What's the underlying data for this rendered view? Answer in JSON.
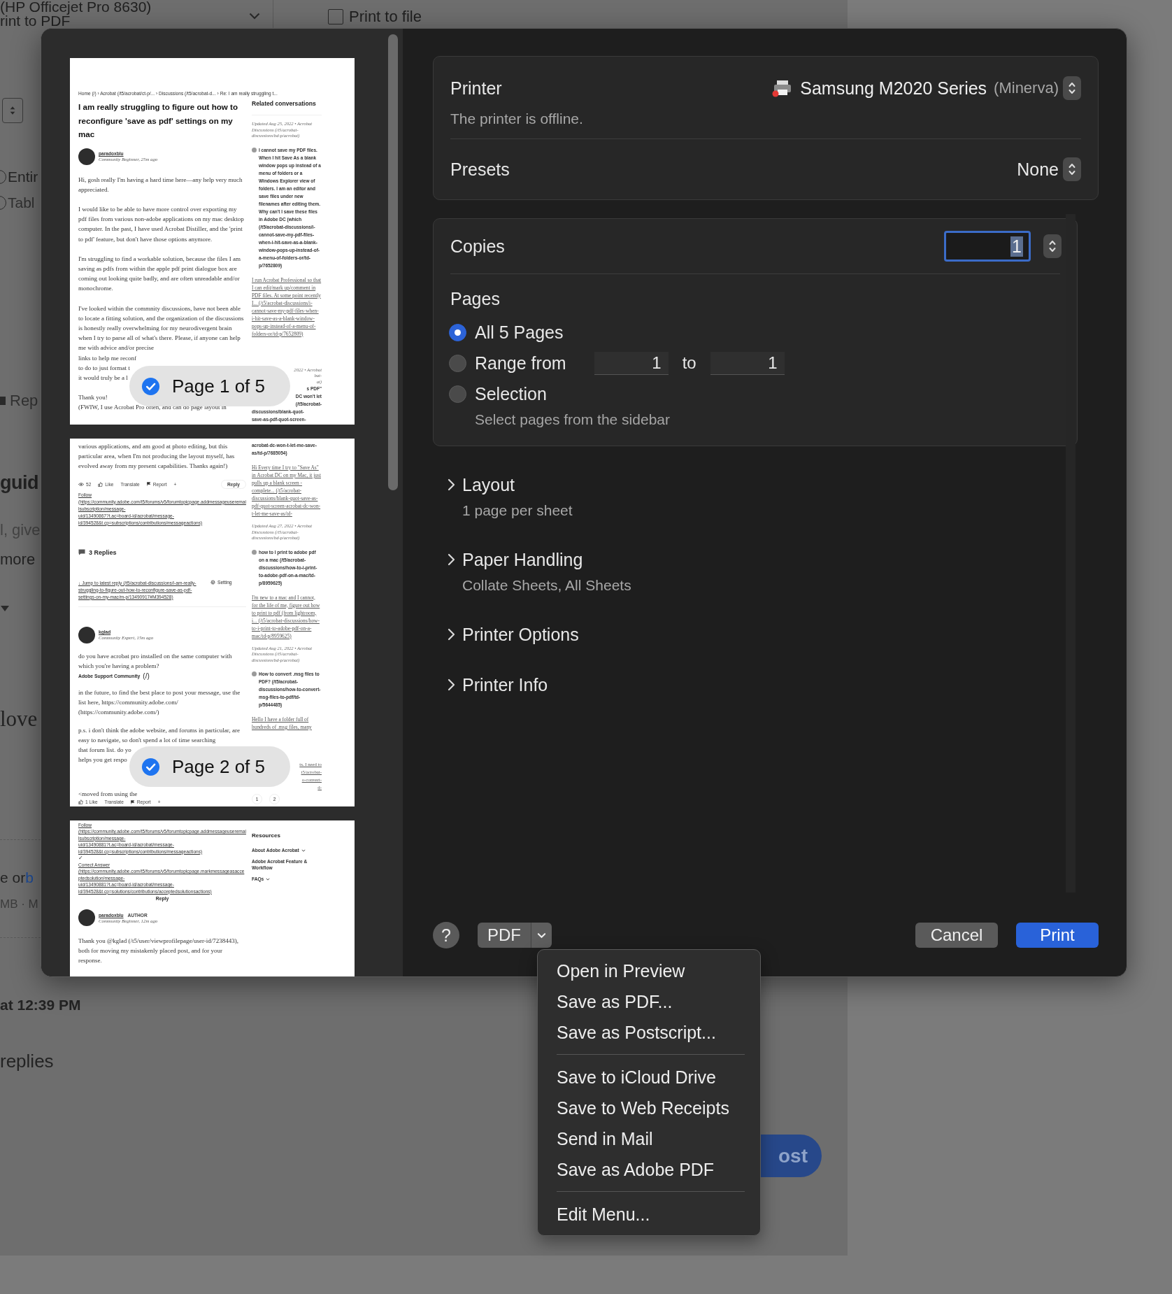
{
  "backdrop": {
    "printer_select": {
      "line_1": "(HP Officejet Pro 8630)",
      "line_2": "rint to PDF"
    },
    "print_to_file": {
      "label": "Print to file",
      "checked": false
    },
    "texts": [
      {
        "kind": "radio",
        "text": "Entir"
      },
      {
        "kind": "radio-muted",
        "text": "Tabl"
      },
      {
        "kind": "flagged",
        "text": "Rep"
      },
      {
        "kind": "heading",
        "text": "guid"
      },
      {
        "kind": "lead-muted",
        "text": "l, give"
      },
      {
        "kind": "lead",
        "text": "more"
      },
      {
        "kind": "serif",
        "text": "love"
      },
      {
        "kind": "linked",
        "text": "e or ",
        "link": "b"
      },
      {
        "kind": "meta",
        "text": "MB · M"
      },
      {
        "kind": "time",
        "text": "at 12:39 PM"
      },
      {
        "kind": "count",
        "text": "replies"
      }
    ],
    "post_button": "ost"
  },
  "preview": {
    "pages": [
      {
        "breadcrumb": "Home (/)  ›  Acrobat (/t5/acrobat/ct-p/...  ›  Discussions (/t5/acrobat-d...  ›  Re: I am really struggling t...",
        "badge": {
          "text": "Page 1 of 5",
          "checked": true
        },
        "main": [
          {
            "kind": "title",
            "text": "I am really struggling to figure out how to reconfigure 'save as pdf' settings on my mac"
          },
          {
            "kind": "author",
            "name": "paradoxblu",
            "role": "Community Beginner, 25m ago"
          },
          {
            "kind": "body",
            "text": "Hi, gosh really I'm having a hard time here—any help very much appreciated."
          },
          {
            "kind": "body",
            "text": "I would like to be able to have more control over exporting my pdf files from various non-adobe applications on my mac desktop computer. In the past, I have used Acrobat Distiller, and the 'print to pdf' feature, but don't have those options anymore."
          },
          {
            "kind": "body",
            "text": "I'm struggling to find a workable solution, because the files I am saving as pdfs from within the apple pdf print dialogue box are coming out looking quite badly, and are often unreadable and/or monochrome."
          },
          {
            "kind": "body",
            "text": "I've looked within the commnity discussions, have not been able to locate a fitting solution, and the organization of the discussions is honestly really overwhelming for my neurodivergent brain when I try to parse all of what's there. Please, if anyone can help me with advice and/or precise"
          },
          {
            "kind": "line",
            "text": "links to help me reconf"
          },
          {
            "kind": "line",
            "text": "to do to just format t"
          },
          {
            "kind": "line",
            "text": "it would truly be a l"
          },
          {
            "kind": "body",
            "text": "Thank you!"
          },
          {
            "kind": "line",
            "text": "(FWIW, I use Acrobat Pro often, and can do page layout in"
          }
        ],
        "side": [
          {
            "kind": "heading",
            "text": "Related conversations"
          },
          {
            "kind": "meta",
            "text": "Updated Aug 25, 2022 • Acrobat Discussions (/t5/acrobat-discussions/bd-p/acrobat)"
          },
          {
            "kind": "topic",
            "text": "I cannot save my PDF files. When I hit Save As a blank window pops up instead of a menu of folders or a Windows Explorer view of folders. I am an editor and save files under new filenames after editing them. Why can't I save these files in Adobe DC (which (/t5/acrobat-discussions/i-cannot-save-my-pdf-files-when-i-hit-save-as-a-blank-window-pops-up-instead-of-a-menu-of-folders-or/td-p/7652809)"
          },
          {
            "kind": "excerpt",
            "text": "I run Acrobat Professional so that I can edit/mark up/comment in PDF files. At some point recently I... (/t5/acrobat-discussions/i-cannot-save-my-pdf-files-when-i-hit-save-as-a-blank-window-pops-up-instead-of-a-menu-of-folders-or/td-p/7652809)"
          },
          {
            "kind": "meta-fragment",
            "text": "2022 • Acrobat"
          },
          {
            "kind": "meta-fragment",
            "text": "bat-"
          },
          {
            "kind": "meta-fragment",
            "text": "at)"
          },
          {
            "kind": "topic-fragment",
            "text": "s PDF\""
          },
          {
            "kind": "topic-fragment",
            "text": "DC won't let"
          },
          {
            "kind": "topic-fragment",
            "text": "(/t5/acrobat-"
          },
          {
            "kind": "topic-line",
            "text": "discussions/blank-quot-"
          },
          {
            "kind": "topic-line",
            "text": "save-as-pdf-quot-screen-"
          }
        ]
      },
      {
        "badge": {
          "text": "Page 2 of 5",
          "checked": true
        },
        "main": [
          {
            "kind": "body",
            "text": "various applications, and am good at photo editing, but this particular area, when I'm not producing the layout myself, has evolved away from my present capabilities. Thanks again!)"
          },
          {
            "kind": "actions",
            "items": [
              {
                "kind": "views",
                "text": "52"
              },
              {
                "kind": "like",
                "text": "Like"
              },
              {
                "kind": "text",
                "text": "Translate"
              },
              {
                "kind": "report",
                "text": "Report"
              },
              {
                "kind": "text",
                "text": "+"
              },
              {
                "kind": "reply",
                "text": "Reply"
              }
            ]
          },
          {
            "kind": "link-line",
            "text": "Follow"
          },
          {
            "kind": "link-line",
            "text": "(https://community.adobe.com/t5/forums/v5/forumtopicpage.addmessageuseremailsubscription/message-"
          },
          {
            "kind": "link-line",
            "text": "uid/13490867?t.ac=board-id/acrobat/message-"
          },
          {
            "kind": "link-line",
            "text": "id/394528&t.cp=subscriptions/contributions/messageactions)"
          },
          {
            "kind": "replies",
            "text": "3 Replies"
          },
          {
            "kind": "jump",
            "text": "↓ Jump to latest reply (/t5/acrobat-discussions/i-am-really-struggling-to-figure-out-how-to-reconfigure-save-as-pdf-settings-on-my-mac/m-p/13490917#M394528)",
            "setting": "Setting"
          },
          {
            "kind": "author",
            "name": "kglad",
            "role": "Community Expert, 15m ago"
          },
          {
            "kind": "body",
            "text": "do you have acrobat pro installed on the same computer with which you're having a problem?"
          },
          {
            "kind": "site-header",
            "text": "Adobe Support Community",
            "link": "(/)"
          },
          {
            "kind": "body",
            "text": "in the future, to find the best place to post your message, use the list here, https://community.adobe.com/ (https://community.adobe.com/)"
          },
          {
            "kind": "body",
            "text": "p.s. i don't think the adobe website, and forums in particular, are easy to navigate, so don't spend a lot of time searching"
          },
          {
            "kind": "line",
            "text": "that forum list. do yo"
          },
          {
            "kind": "line",
            "text": "helps you get respo"
          },
          {
            "kind": "body",
            "text": "<moved from using the"
          },
          {
            "kind": "actions",
            "items": [
              {
                "kind": "like",
                "text": "1 Like"
              },
              {
                "kind": "text",
                "text": "Translate"
              },
              {
                "kind": "report",
                "text": "Report"
              },
              {
                "kind": "text",
                "text": "+"
              }
            ]
          }
        ],
        "side": [
          {
            "kind": "topic-line",
            "text": "acrobat-dc-won-t-let-me-save-as/td-p/7685054)"
          },
          {
            "kind": "excerpt",
            "text": "Hi Every time I try to \"Save As\" in Acrobat DC on my Mac, it just pulls up a blank screen - complete... (/t5/acrobat-discussions/blank-quot-save-as-pdf-quot-screen-acrobat-dc-won-t-let-me-save-as/td-"
          },
          {
            "kind": "meta",
            "text": "Updated Aug 27, 2022 • Acrobat Discussions (/t5/acrobat-discussions/bd-p/acrobat)"
          },
          {
            "kind": "topic",
            "text": "how to I print to adobe pdf on a mac (/t5/acrobat-discussions/how-to-i-print-to-adobe-pdf-on-a-mac/td-p/8959625)"
          },
          {
            "kind": "excerpt",
            "text": "I'm new to a mac and I cannot, for the life of me, figure out how to print to pdf (from lightroom, i... (/t5/acrobat-discussions/how-to-i-print-to-adobe-pdf-on-a-mac/td-p/8959625)"
          },
          {
            "kind": "meta",
            "text": "Updated Aug 21, 2022 • Acrobat Discussions (/t5/acrobat-discussions/bd-p/acrobat)"
          },
          {
            "kind": "topic",
            "text": "How to convert .msg files to PDF? (/t5/acrobat-discussions/how-to-convert-msg-files-to-pdf/td-p/5644485)"
          },
          {
            "kind": "excerpt",
            "text": "Hello I have a folder full of hundreds of .msg files, many"
          },
          {
            "kind": "excerpt-fragment",
            "text": "ts. I need to"
          },
          {
            "kind": "excerpt-fragment",
            "text": "t5/acrobat-"
          },
          {
            "kind": "excerpt-fragment",
            "text": "o-convert-"
          },
          {
            "kind": "excerpt-fragment",
            "text": "d-"
          },
          {
            "kind": "pager",
            "items": [
              "1",
              "2"
            ]
          }
        ]
      },
      {
        "main": [
          {
            "kind": "link-line",
            "text": "Follow"
          },
          {
            "kind": "link-line",
            "text": "(https://community.adobe.com/t5/forums/v5/forumtopicpage.addmessageuseremailsubscription/message-"
          },
          {
            "kind": "link-line",
            "text": "uid/13490881?t.ac=board-id/acrobat/message-"
          },
          {
            "kind": "link-line",
            "text": "id/394528&t.cp=subscriptions/contributions/messageactions)"
          },
          {
            "kind": "check",
            "text": "✓"
          },
          {
            "kind": "link-line",
            "text": "Correct Answer"
          },
          {
            "kind": "link-line",
            "text": "(https://community.adobe.com/t5/forums/v5/forumtopicpage.markmessageasacceptedsolution/message-"
          },
          {
            "kind": "link-line",
            "text": "uid/13490881?t.ac=board-id/acrobat/message-"
          },
          {
            "kind": "link-line",
            "text": "id/394528&t.cp=solutions/contributions/acceptedsolutionsactions)"
          },
          {
            "kind": "reply-label",
            "text": "Reply"
          },
          {
            "kind": "author",
            "name": "paradoxblu",
            "badge": "AUTHOR",
            "role": "Community Beginner, 12m ago"
          },
          {
            "kind": "body",
            "text": "Thank you @kglad (/t5/user/viewprofilepage/user-id/7238443), both for moving my mistakenly placed post, and for your response."
          }
        ],
        "side": [
          {
            "kind": "heading",
            "text": "Resources"
          },
          {
            "kind": "dropdown",
            "text": "About Adobe Acrobat"
          },
          {
            "kind": "topic-line",
            "text": "Adobe Acrobat Feature & Workflow"
          },
          {
            "kind": "dropdown",
            "text": "FAQs"
          }
        ]
      }
    ]
  },
  "printer": {
    "label": "Printer",
    "name": "Samsung M2020 Series",
    "location": "(Minerva)",
    "status": "The printer is offline.",
    "offline": true
  },
  "presets": {
    "label": "Presets",
    "value": "None"
  },
  "copies": {
    "label": "Copies",
    "value": "1",
    "focused": true
  },
  "pages": {
    "label": "Pages",
    "options": [
      {
        "kind": "all",
        "label": "All 5 Pages",
        "selected": true
      },
      {
        "kind": "range",
        "label": "Range from",
        "selected": false,
        "from": "1",
        "to_label": "to",
        "to": "1"
      },
      {
        "kind": "selection",
        "label": "Selection",
        "selected": false,
        "hint": "Select pages from the sidebar"
      }
    ]
  },
  "sections": [
    {
      "title": "Layout",
      "summary": "1 page per sheet",
      "expanded": false
    },
    {
      "title": "Paper Handling",
      "summary": "Collate Sheets, All Sheets",
      "expanded": false
    },
    {
      "title": "Printer Options",
      "expanded": false
    },
    {
      "title": "Printer Info",
      "expanded": false
    }
  ],
  "footer": {
    "help": "?",
    "pdf": "PDF",
    "cancel": "Cancel",
    "print": "Print"
  },
  "pdf_menu": [
    {
      "kind": "item",
      "text": "Open in Preview"
    },
    {
      "kind": "item",
      "text": "Save as PDF..."
    },
    {
      "kind": "item",
      "text": "Save as Postscript..."
    },
    {
      "kind": "separator"
    },
    {
      "kind": "item",
      "text": "Save to iCloud Drive"
    },
    {
      "kind": "item",
      "text": "Save to Web Receipts"
    },
    {
      "kind": "item",
      "text": "Send in Mail"
    },
    {
      "kind": "item",
      "text": "Save as Adobe PDF"
    },
    {
      "kind": "separator"
    },
    {
      "kind": "item",
      "text": "Edit Menu..."
    }
  ]
}
